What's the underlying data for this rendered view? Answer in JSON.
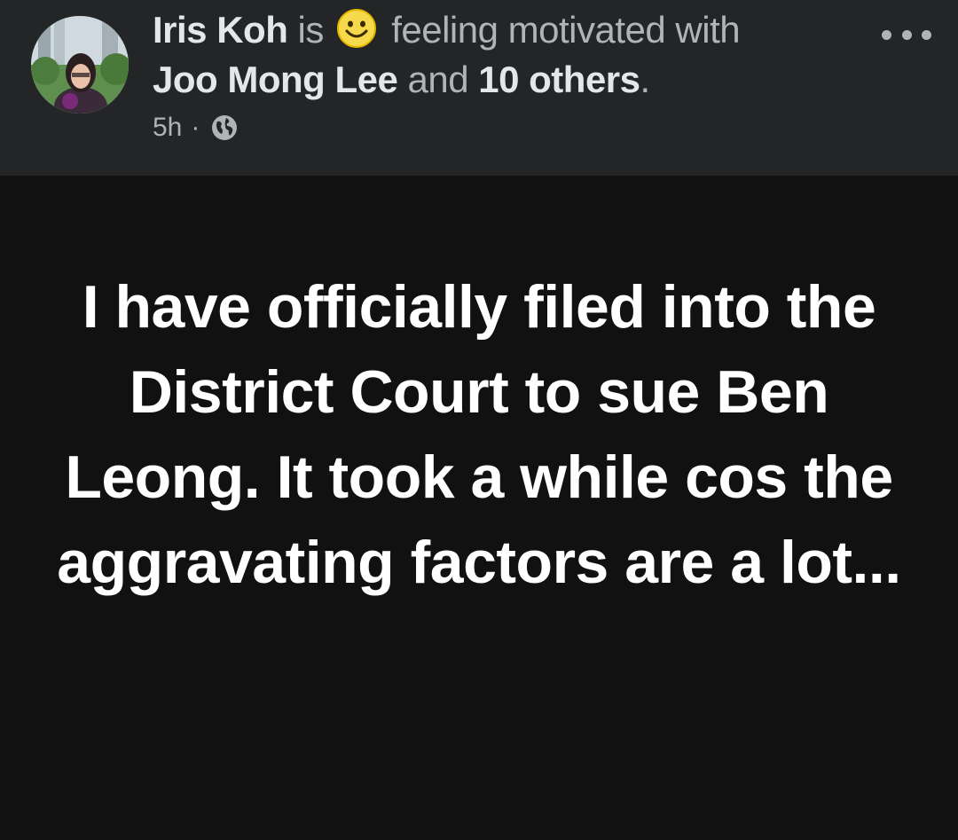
{
  "post": {
    "author": "Iris Koh",
    "is_word": "is",
    "feeling_text": "feeling motivated with",
    "tagged_person": "Joo Mong Lee",
    "and_word": "and",
    "others": "10 others",
    "period": ".",
    "time": "5h",
    "separator": "·",
    "privacy_icon": "globe-icon",
    "feeling_icon": "smiling-emoji-icon",
    "message": "I have officially filed into the District Court to sue Ben Leong. It took a while cos the aggravating factors are a lot...",
    "more_icon": "more-options-icon"
  },
  "colors": {
    "header_bg": "#242526",
    "body_bg": "#111111",
    "primary_text": "#e4e6eb",
    "secondary_text": "#b0b3b8",
    "message_text": "#ffffff",
    "emoji_yellow": "#f7d94c"
  }
}
